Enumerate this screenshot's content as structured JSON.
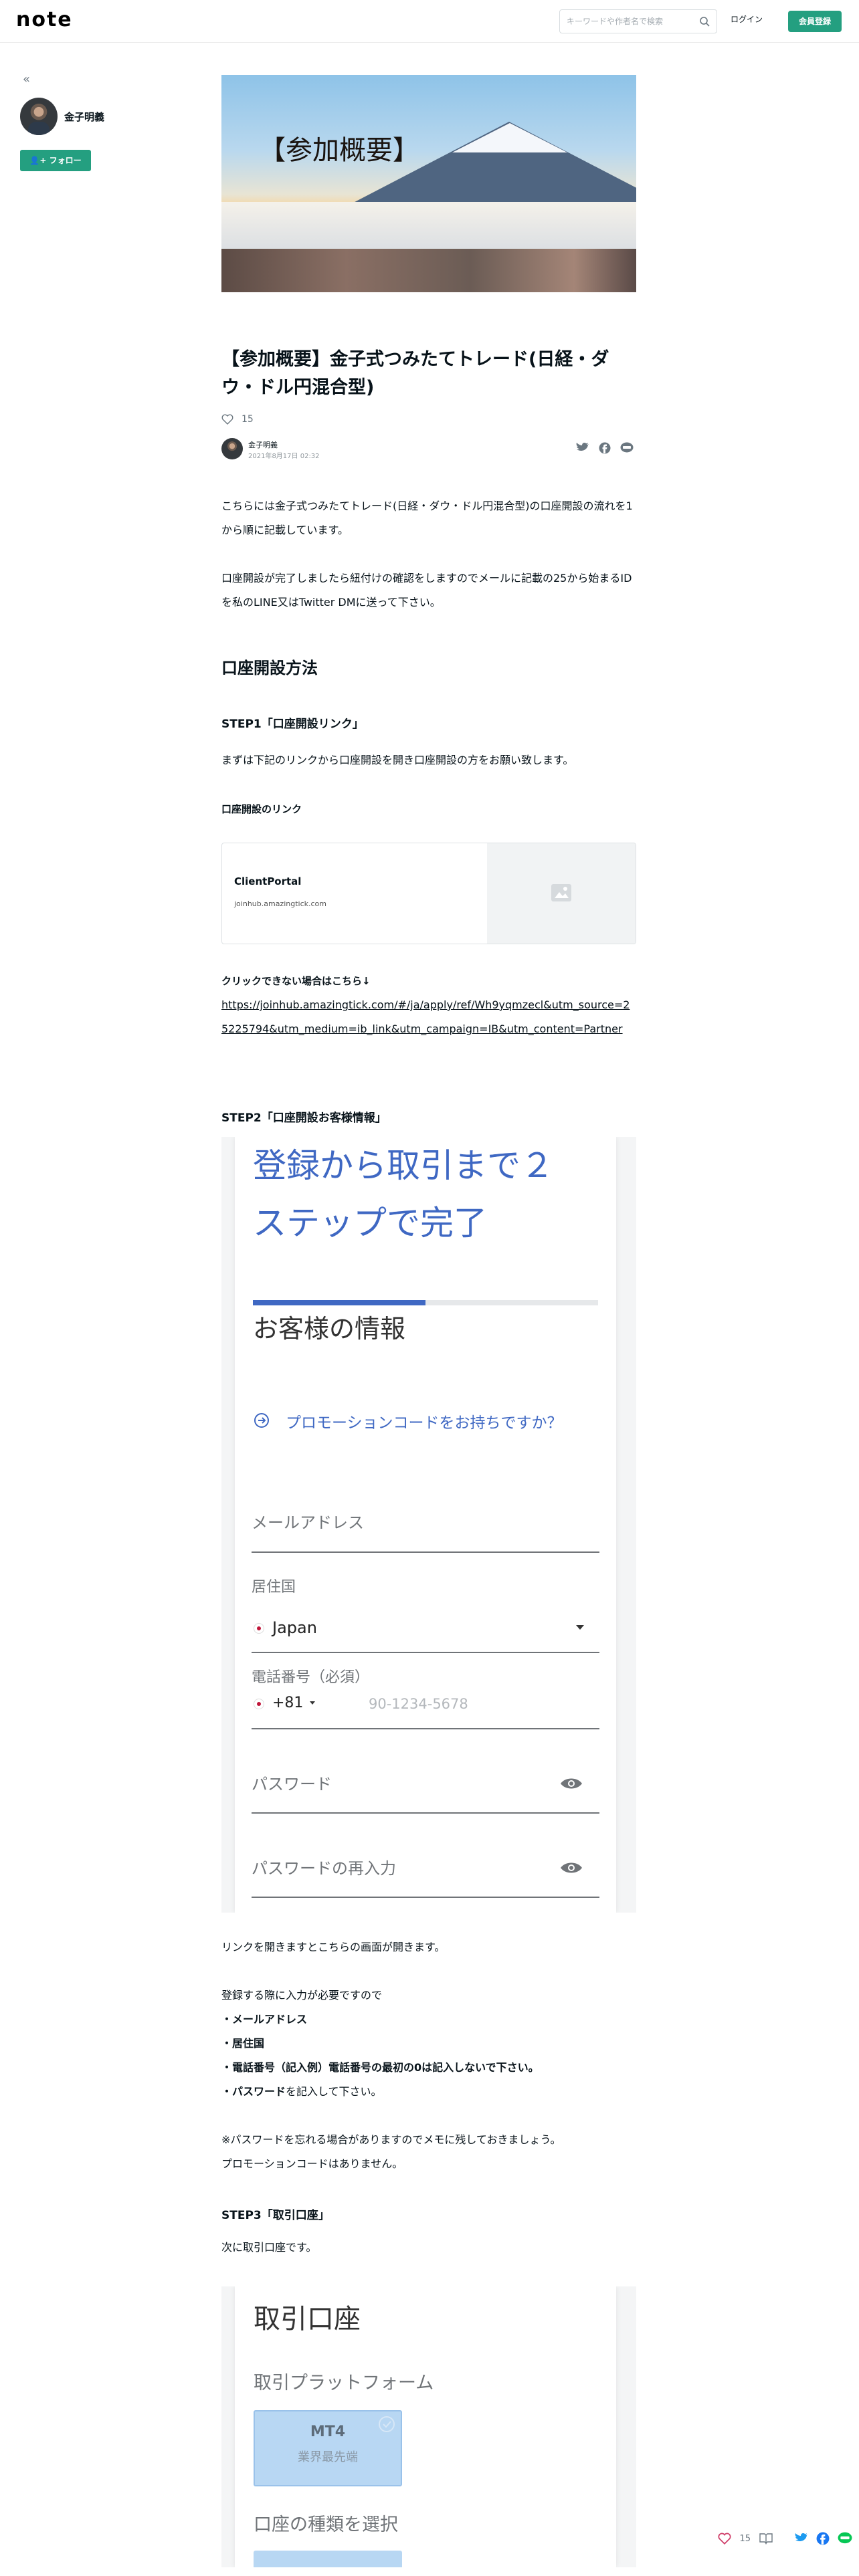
{
  "header": {
    "logo": "note",
    "search_placeholder": "キーワードや作者名で検索",
    "login": "ログイン",
    "signup": "会員登録"
  },
  "creator": {
    "name": "金子明義",
    "follow": "フォロー"
  },
  "eyecatch": {
    "text": "【参加概要】"
  },
  "article": {
    "title": "【参加概要】金子式つみたてトレード(日経・ダウ・ドル円混合型)",
    "likes": "15",
    "author": "金子明義",
    "date": "2021年8月17日 02:32",
    "intro1": "こちらには金子式つみたてトレード(日経・ダウ・ドル円混合型)の口座開設の流れを1から順に記載しています。",
    "intro2": "口座開設が完了しましたら紐付けの確認をしますのでメールに記載の25から始まるIDを私のLINE又はTwitter DMに送って下さい。",
    "h2": "口座開設方法",
    "step1": "STEP1「口座開設リンク」",
    "step1_text": "まずは下記のリンクから口座開設を開き口座開設の方をお願い致します。",
    "link_heading": "口座開設のリンク",
    "embed_title": "ClientPortal",
    "embed_url": "joinhub.amazingtick.com",
    "fallback_heading": "クリックできない場合はこちら↓",
    "fallback_link": "https://joinhub.amazingtick.com/#/ja/apply/ref/Wh9yqmzecl&utm_source=25225794&utm_medium=ib_link&utm_campaign=IB&utm_content=Partner",
    "step2": "STEP2「口座開設お客様情報」",
    "after_shot": "リンクを開きますとこちらの画面が開きます。",
    "required_intro": "登録する際に入力が必要ですので",
    "req_items": [
      "・メールアドレス",
      "・居住国",
      "・電話番号（記入例）電話番号の最初の0は記入しないで下さい。"
    ],
    "req_last_bold": "・パスワード",
    "req_last_rest": "を記入して下さい。",
    "note1": "※パスワードを忘れる場合がありますのでメモに残しておきましょう。",
    "note2": "プロモーションコードはありません。",
    "step3": "STEP3「取引口座」",
    "step3_text": "次に取引口座です。"
  },
  "form_shot": {
    "headline1": "登録から取引まで２",
    "headline2": "ステップで完了",
    "section": "お客様の情報",
    "promo": "プロモーションコードをお持ちですか？",
    "email": "メールアドレス",
    "country_label": "居住国",
    "country_value": "Japan",
    "phone_label": "電話番号（必須）",
    "phone_code": "+81",
    "phone_placeholder": "90-1234-5678",
    "password": "パスワード",
    "password_confirm": "パスワードの再入力",
    "progress": 0.5
  },
  "account_shot": {
    "title": "取引口座",
    "platform_label": "取引プラットフォーム",
    "platform_name": "MT4",
    "platform_sub": "業界最先端",
    "type_label": "口座の種類を選択"
  },
  "floating_bar": {
    "likes": "15"
  },
  "colors": {
    "accent": "#249f80",
    "form_blue": "#3f68c3",
    "text": "#08131a"
  }
}
